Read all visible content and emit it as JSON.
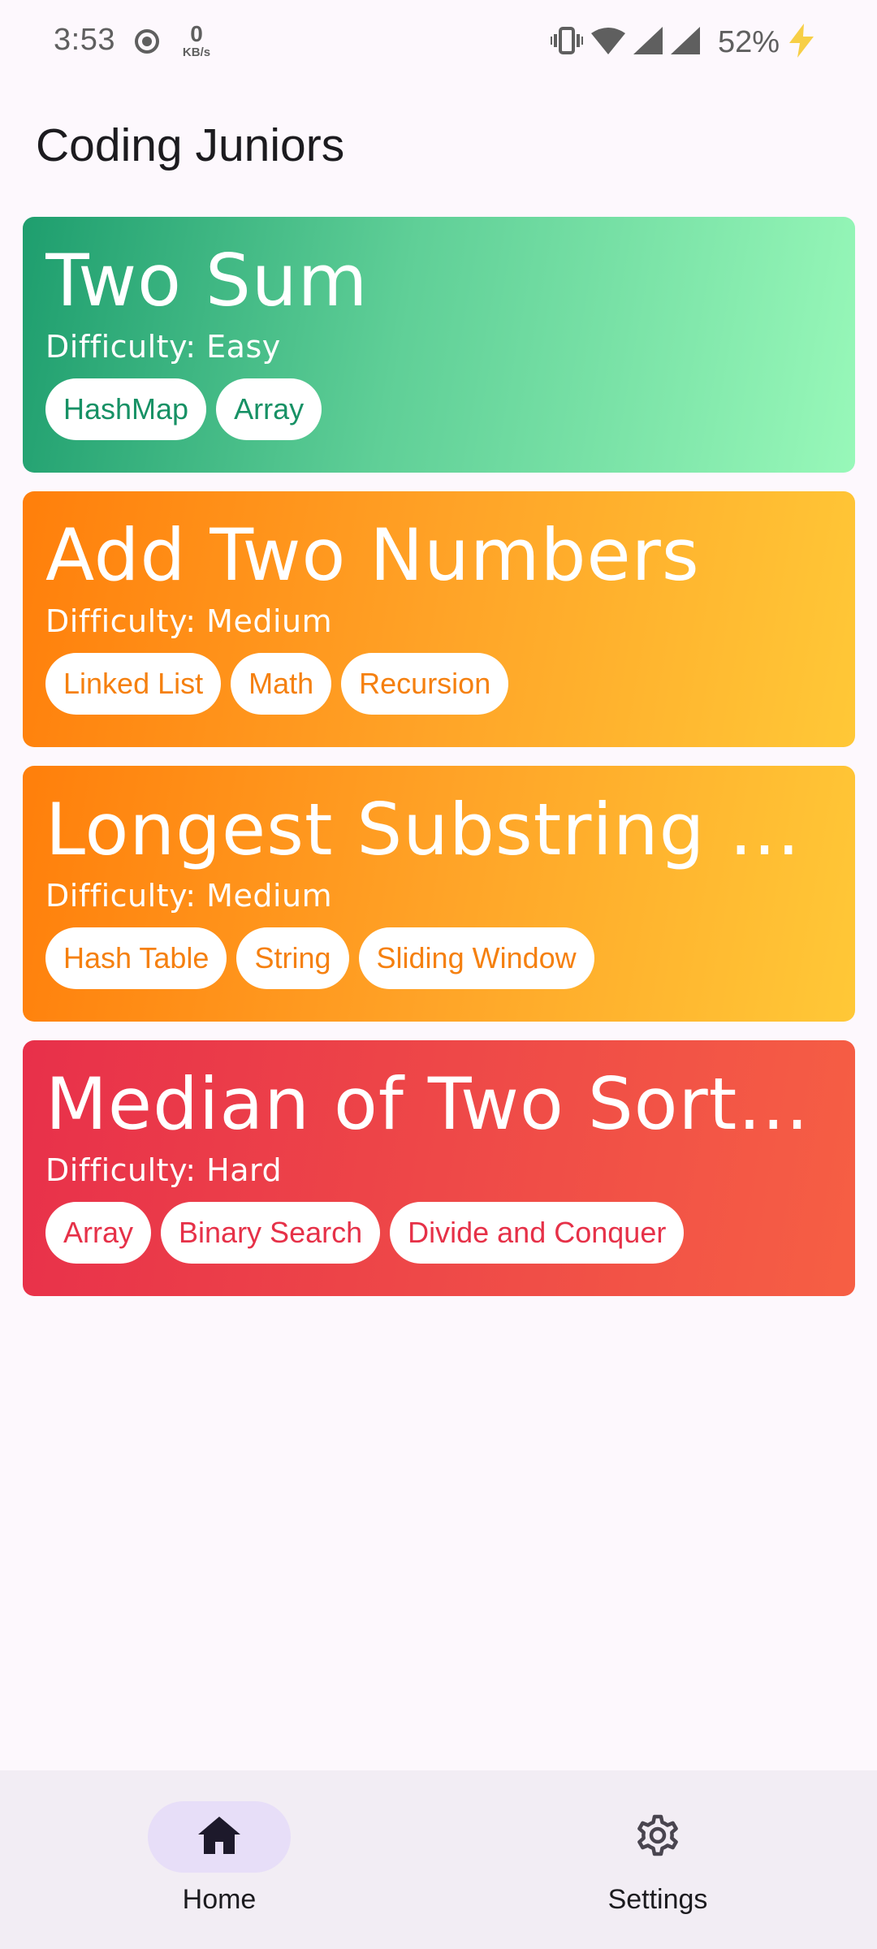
{
  "status_bar": {
    "time": "3:53",
    "data_speed_value": "0",
    "data_speed_unit": "KB/s",
    "battery": "52%"
  },
  "app_bar": {
    "title": "Coding Juniors"
  },
  "problems": [
    {
      "title": "Two Sum",
      "difficulty": "Difficulty: Easy",
      "tags": [
        "HashMap",
        "Array"
      ]
    },
    {
      "title": "Add Two Numbers",
      "difficulty": "Difficulty: Medium",
      "tags": [
        "Linked List",
        "Math",
        "Recursion"
      ]
    },
    {
      "title": "Longest Substring Without Repeating Characters",
      "difficulty": "Difficulty: Medium",
      "tags": [
        "Hash Table",
        "String",
        "Sliding Window"
      ]
    },
    {
      "title": "Median of Two Sorted Arrays",
      "difficulty": "Difficulty: Hard",
      "tags": [
        "Array",
        "Binary Search",
        "Divide and Conquer"
      ]
    }
  ],
  "colors": {
    "easy_gradient": [
      "#1e9e6e",
      "#98f8b9"
    ],
    "medium_gradient": [
      "#ff7f0b",
      "#ffc837"
    ],
    "hard_gradient": [
      "#e8304a",
      "#f65f44"
    ],
    "easy_tag_text": "#179165",
    "medium_tag_text": "#f5800f",
    "hard_tag_text": "#e63148"
  },
  "bottom_nav": {
    "home_label": "Home",
    "settings_label": "Settings"
  }
}
